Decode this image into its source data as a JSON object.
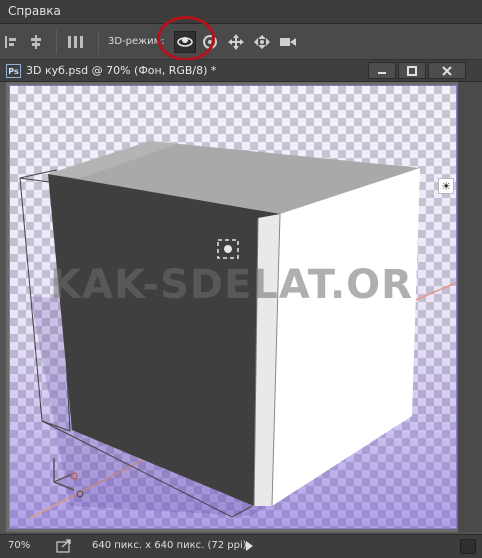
{
  "menu": {
    "help": "Справка"
  },
  "options_bar": {
    "mode_label": "3D-режим:",
    "icons": [
      "align-left-icon",
      "align-center-icon",
      "distribute-icon",
      "rotate-3d-icon",
      "roll-3d-icon",
      "pan-3d-icon",
      "slide-3d-icon",
      "scale-3d-icon"
    ]
  },
  "document": {
    "ps_badge": "Ps",
    "title": "3D куб.psd @ 70% (Фон, RGB/8) *",
    "watermark": "KAK-SDELAT.OR",
    "light_icon": "☀"
  },
  "status": {
    "zoom": "70%",
    "doc_info": "640 пикс. x 640 пикс. (72 ppi)"
  },
  "colors": {
    "highlight_circle": "#b5121b",
    "cube_front": "#3f3f3f",
    "cube_top": "#a8a8a8",
    "cube_side": "#ffffff",
    "ground_tint": "#8f72d9"
  }
}
